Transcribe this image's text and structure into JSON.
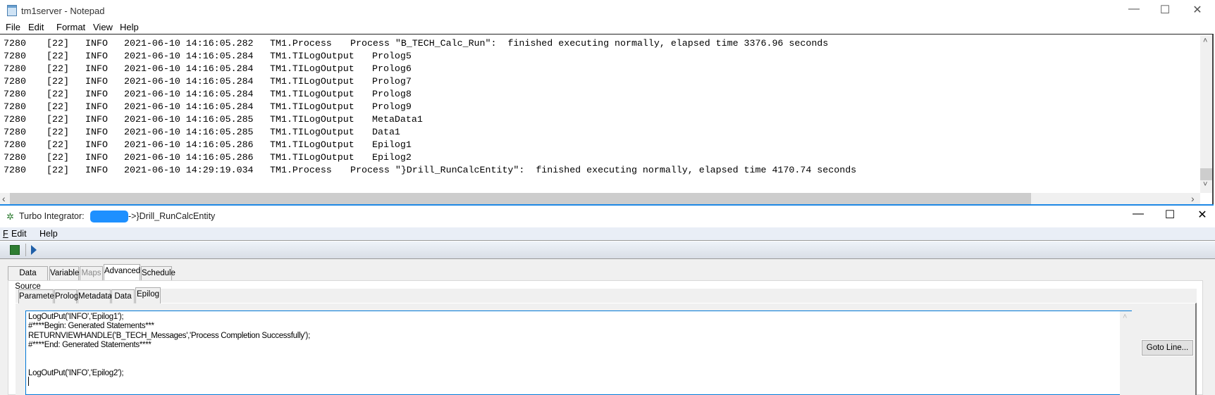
{
  "notepad": {
    "title": "tm1server - Notepad",
    "menu": [
      "File",
      "Edit",
      "Format",
      "View",
      "Help"
    ],
    "log_rows": [
      [
        "7280",
        "[22]",
        "INFO",
        "2021-06-10 14:16:05.282",
        "TM1.Process",
        "Process \"B_TECH_Calc_Run\":  finished executing normally, elapsed time 3376.96 seconds"
      ],
      [
        "7280",
        "[22]",
        "INFO",
        "2021-06-10 14:16:05.284",
        "TM1.TILogOutput",
        "Prolog5"
      ],
      [
        "7280",
        "[22]",
        "INFO",
        "2021-06-10 14:16:05.284",
        "TM1.TILogOutput",
        "Prolog6"
      ],
      [
        "7280",
        "[22]",
        "INFO",
        "2021-06-10 14:16:05.284",
        "TM1.TILogOutput",
        "Prolog7"
      ],
      [
        "7280",
        "[22]",
        "INFO",
        "2021-06-10 14:16:05.284",
        "TM1.TILogOutput",
        "Prolog8"
      ],
      [
        "7280",
        "[22]",
        "INFO",
        "2021-06-10 14:16:05.284",
        "TM1.TILogOutput",
        "Prolog9"
      ],
      [
        "7280",
        "[22]",
        "INFO",
        "2021-06-10 14:16:05.285",
        "TM1.TILogOutput",
        "MetaData1"
      ],
      [
        "7280",
        "[22]",
        "INFO",
        "2021-06-10 14:16:05.285",
        "TM1.TILogOutput",
        "Data1"
      ],
      [
        "7280",
        "[22]",
        "INFO",
        "2021-06-10 14:16:05.286",
        "TM1.TILogOutput",
        "Epilog1"
      ],
      [
        "7280",
        "[22]",
        "INFO",
        "2021-06-10 14:16:05.286",
        "TM1.TILogOutput",
        "Epilog2"
      ],
      [
        "7280",
        "[22]",
        "INFO",
        "2021-06-10 14:29:19.034",
        "TM1.Process",
        "Process \"}Drill_RunCalcEntity\":  finished executing normally, elapsed time 4170.74 seconds"
      ]
    ]
  },
  "ti": {
    "title_prefix": "Turbo Integrator:",
    "title_process": "->}Drill_RunCalcEntity",
    "redaction_color": "#1e90ff",
    "menu": [
      "F",
      "Edit",
      "Help"
    ],
    "tabs": [
      {
        "label": "Data Source",
        "state": "normal"
      },
      {
        "label": "Variables",
        "state": "normal"
      },
      {
        "label": "Maps",
        "state": "disabled"
      },
      {
        "label": "Advanced",
        "state": "selected"
      },
      {
        "label": "Schedule",
        "state": "normal"
      }
    ],
    "subtabs": [
      {
        "label": "Parameters",
        "state": "normal"
      },
      {
        "label": "Prolog",
        "state": "normal"
      },
      {
        "label": "Metadata",
        "state": "normal"
      },
      {
        "label": "Data",
        "state": "normal"
      },
      {
        "label": "Epilog",
        "state": "selected"
      }
    ],
    "code_lines": [
      "LogOutPut('INFO','Epilog1');",
      "#****Begin: Generated Statements***",
      "RETURNVIEWHANDLE('B_TECH_Messages','Process Completion Successfully');",
      "#****End: Generated Statements****",
      "",
      "",
      "LogOutPut('INFO','Epilog2');"
    ],
    "goto_label": "Goto Line..."
  },
  "icons": {
    "minimize": "—",
    "maximize": "☐",
    "close": "✕",
    "left": "‹",
    "right": "›",
    "up": "˄",
    "down": "˅"
  }
}
